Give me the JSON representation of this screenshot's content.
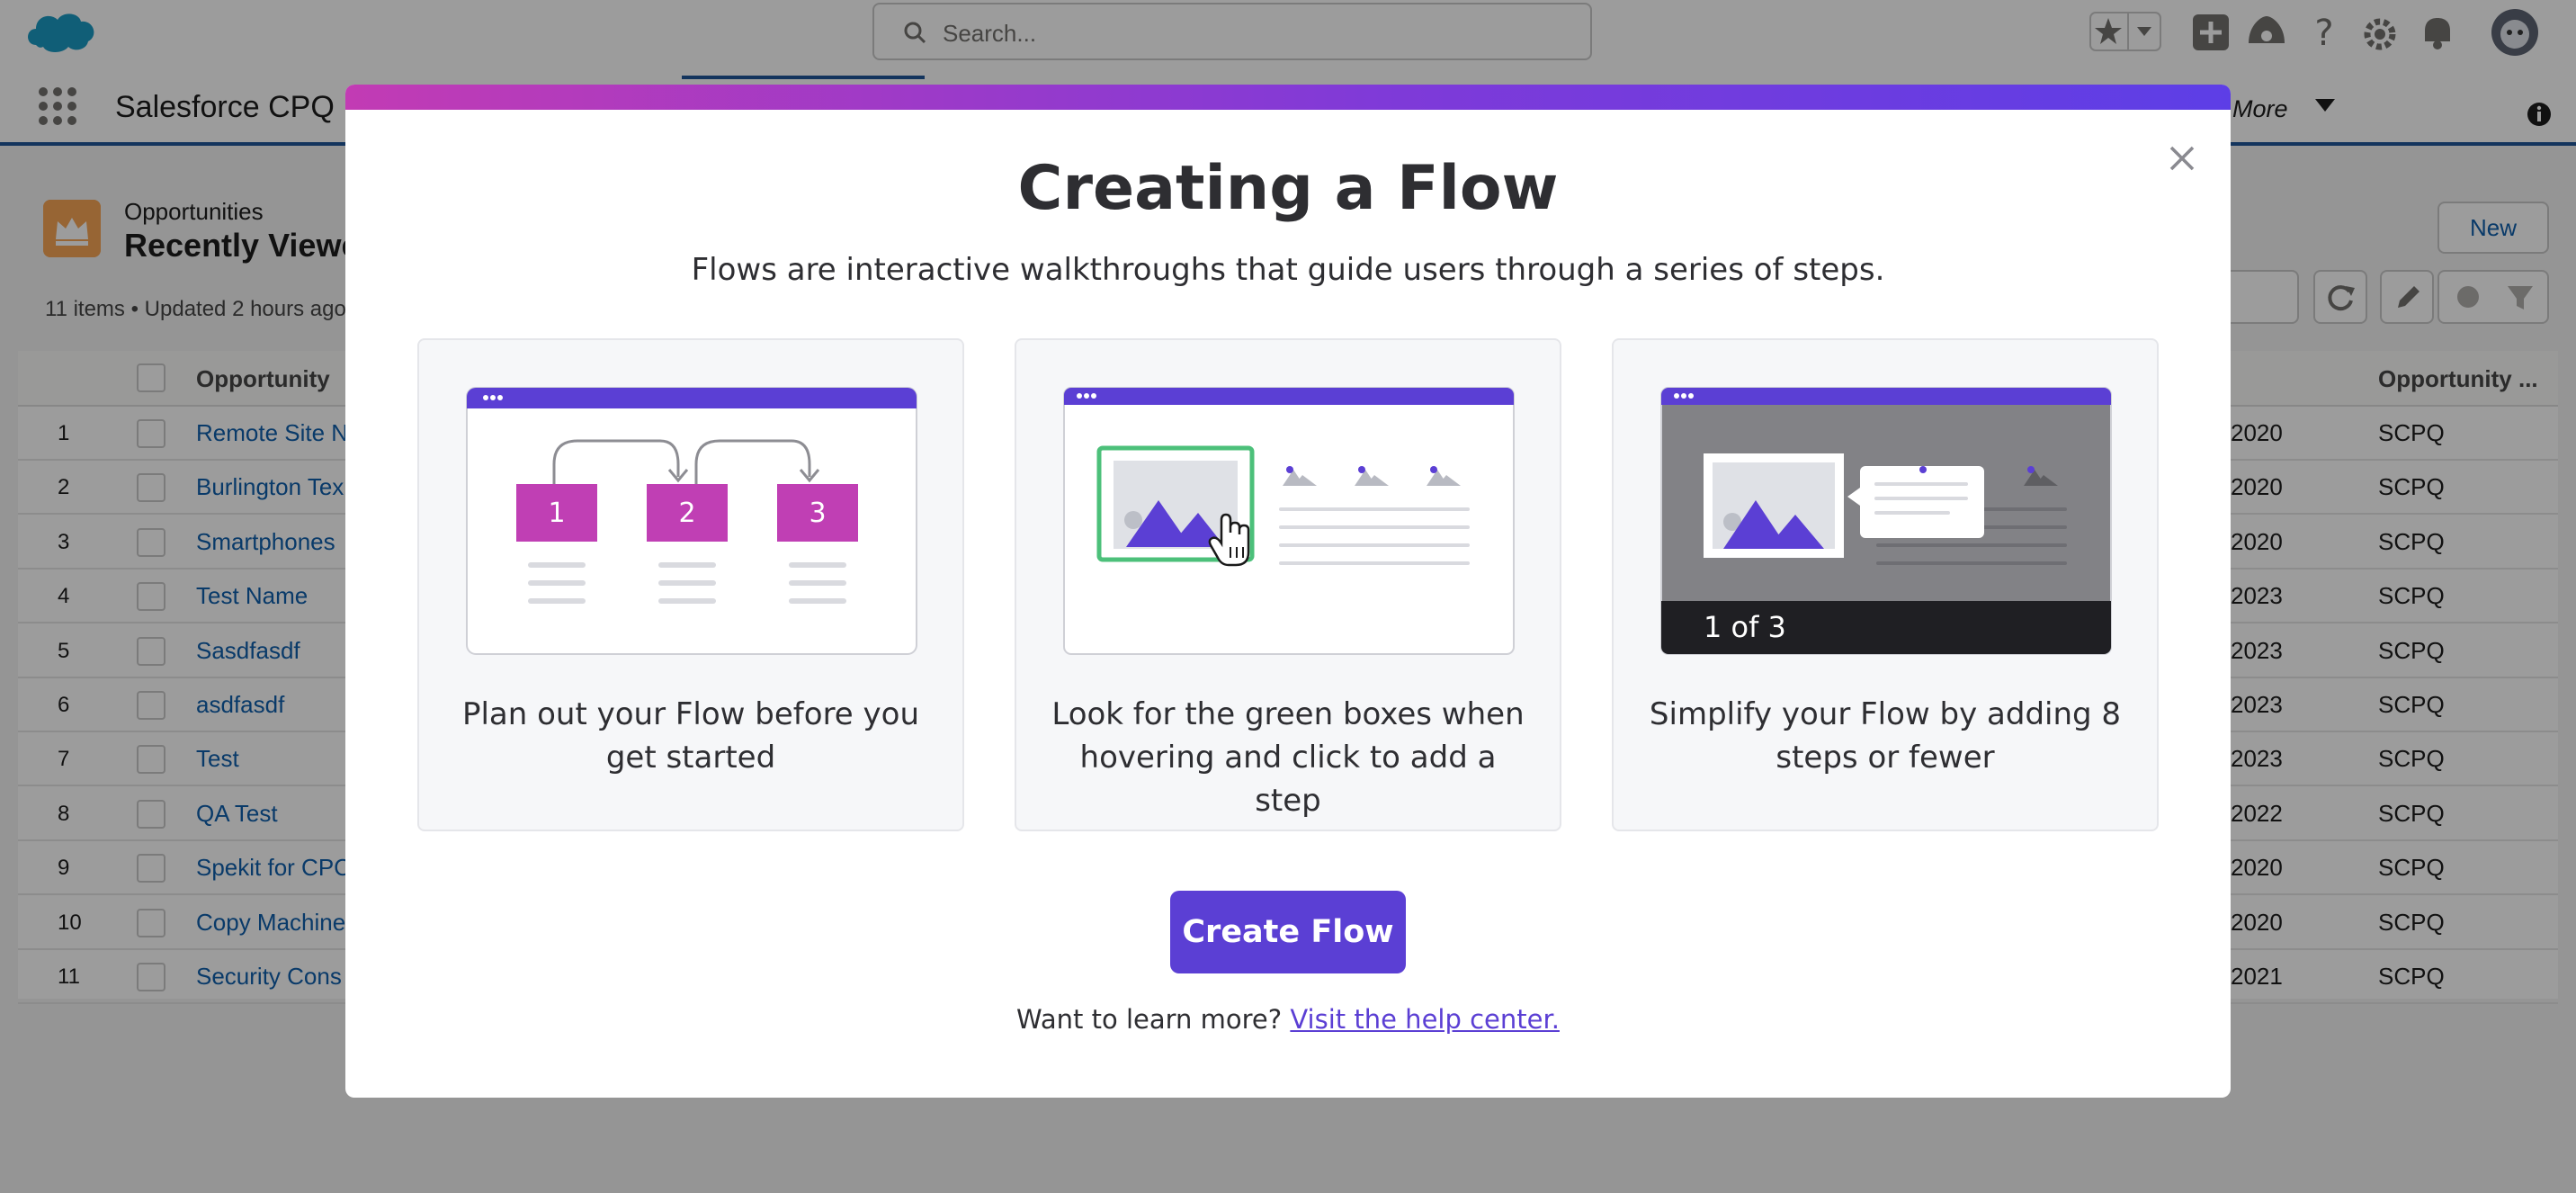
{
  "topbar": {
    "search_placeholder": "Search..."
  },
  "navbar": {
    "app_name": "Salesforce CPQ",
    "more_label": "More"
  },
  "list_view": {
    "object_label": "Opportunities",
    "view_title": "Recently Viewed",
    "meta": "11 items • Updated 2 hours ago",
    "new_button": "New",
    "columns": [
      "Opportunity",
      "Opportunity ..."
    ],
    "rows": [
      {
        "num": "1",
        "name": "Remote Site N",
        "year": "2020",
        "col2": "SCPQ"
      },
      {
        "num": "2",
        "name": "Burlington Tex",
        "year": "2020",
        "col2": "SCPQ"
      },
      {
        "num": "3",
        "name": "Smartphones",
        "year": "2020",
        "col2": "SCPQ"
      },
      {
        "num": "4",
        "name": "Test Name",
        "year": "2023",
        "col2": "SCPQ"
      },
      {
        "num": "5",
        "name": "Sasdfasdf",
        "year": "2023",
        "col2": "SCPQ"
      },
      {
        "num": "6",
        "name": "asdfasdf",
        "year": "2023",
        "col2": "SCPQ"
      },
      {
        "num": "7",
        "name": "Test",
        "year": "2023",
        "col2": "SCPQ"
      },
      {
        "num": "8",
        "name": "QA Test",
        "year": "2022",
        "col2": "SCPQ"
      },
      {
        "num": "9",
        "name": "Spekit for CPC",
        "year": "2020",
        "col2": "SCPQ"
      },
      {
        "num": "10",
        "name": "Copy Machine",
        "year": "2020",
        "col2": "SCPQ"
      },
      {
        "num": "11",
        "name": "Security Cons",
        "year": "2021",
        "col2": "SCPQ"
      }
    ]
  },
  "modal": {
    "title": "Creating a Flow",
    "subtitle": "Flows are interactive walkthroughs that guide users through a series of steps.",
    "cards": [
      {
        "text": "Plan out your Flow before you get started",
        "steps": [
          "1",
          "2",
          "3"
        ]
      },
      {
        "text": "Look for the green boxes when hovering and click to add a step"
      },
      {
        "text": "Simplify your Flow by adding 8 steps or fewer",
        "badge": "1 of 3"
      }
    ],
    "create_button": "Create Flow",
    "learn_prefix": "Want to learn more? ",
    "learn_link": "Visit the help center."
  },
  "colors": {
    "brand_purple": "#5b3fd4",
    "step_magenta": "#c03fb4",
    "hover_green": "#4cc07a",
    "link_blue": "#0b5cab"
  }
}
